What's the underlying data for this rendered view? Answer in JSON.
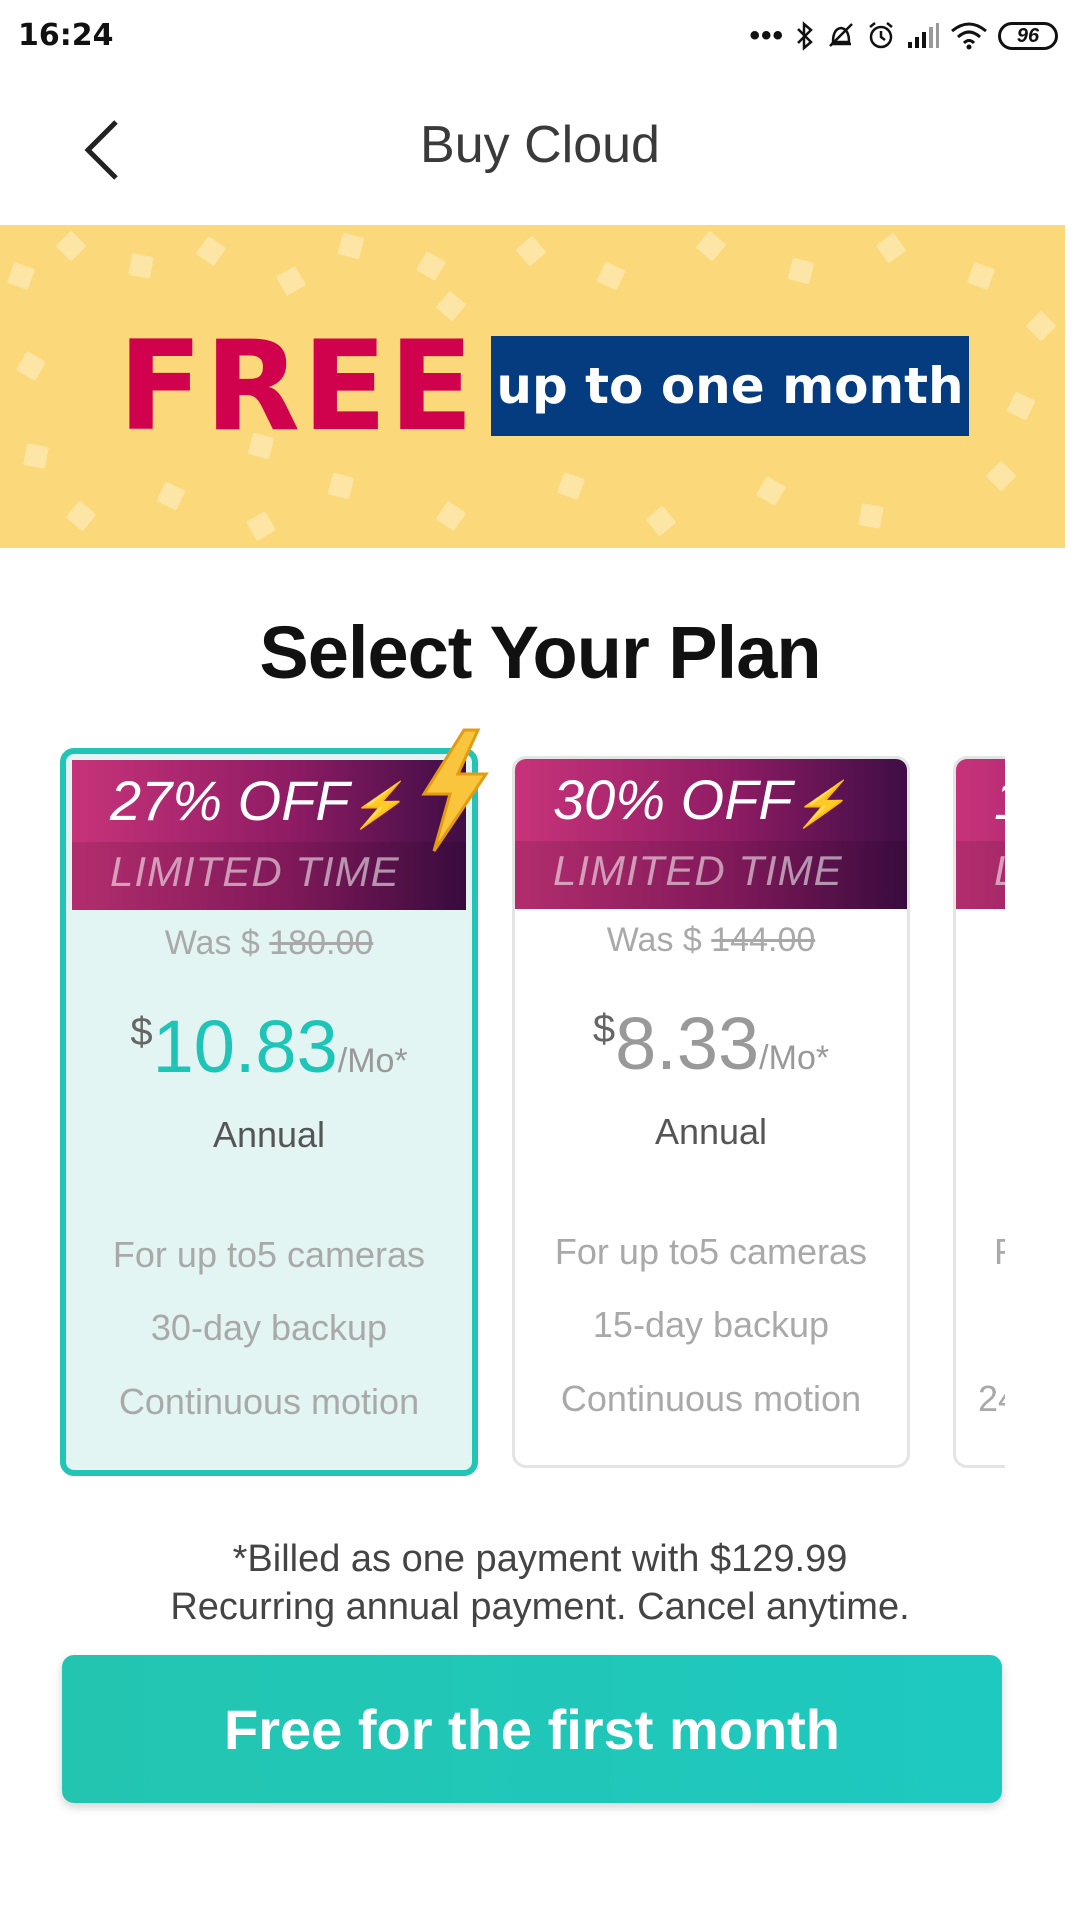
{
  "status_bar": {
    "time": "16:24",
    "battery": "96"
  },
  "header": {
    "title": "Buy Cloud"
  },
  "banner": {
    "free": "FREE",
    "subtitle": "up to one month"
  },
  "section_title": "Select Your Plan",
  "plans": [
    {
      "discount": "27% OFF",
      "limited": "LIMITED TIME",
      "was_label": "Was $",
      "was_price": "180.00",
      "currency": "$",
      "price": "10.83",
      "unit": "/Mo*",
      "period": "Annual",
      "features": [
        "For up to5 cameras",
        "30-day backup",
        "Continuous motion"
      ],
      "selected": true
    },
    {
      "discount": "30% OFF",
      "limited": "LIMITED TIME",
      "was_label": "Was $",
      "was_price": "144.00",
      "currency": "$",
      "price": "8.33",
      "unit": "/Mo*",
      "period": "Annual",
      "features": [
        "For up to5 cameras",
        "15-day backup",
        "Continuous motion"
      ],
      "selected": false
    },
    {
      "discount": "1",
      "limited": "L",
      "features": [
        "F",
        "",
        "24"
      ],
      "selected": false
    }
  ],
  "billing": {
    "line1": "*Billed as one payment with $129.99",
    "line2": "Recurring annual payment. Cancel anytime."
  },
  "cta": {
    "label": "Free for the first month"
  },
  "colors": {
    "accent": "#1ec4b6",
    "banner_bg": "#fbd879",
    "free_red": "#d1024d",
    "navy": "#053c80"
  }
}
